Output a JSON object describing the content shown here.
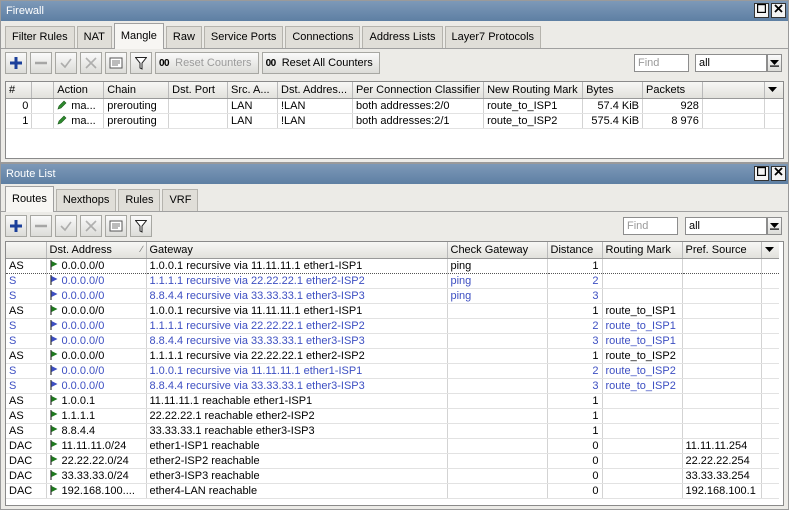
{
  "firewall": {
    "title": "Firewall",
    "tabs": [
      "Filter Rules",
      "NAT",
      "Mangle",
      "Raw",
      "Service Ports",
      "Connections",
      "Address Lists",
      "Layer7 Protocols"
    ],
    "active_tab": 2,
    "reset_counters_label": "Reset Counters",
    "reset_all_counters_label": "Reset All Counters",
    "counter_icon_text": "00",
    "find_placeholder": "Find",
    "filter_value": "all",
    "columns": [
      "#",
      "",
      "Action",
      "Chain",
      "Dst. Port",
      "Src. A...",
      "Dst. Addres...",
      "Per Connection Classifier",
      "New Routing Mark",
      "Bytes",
      "Packets"
    ],
    "rows": [
      {
        "num": "0",
        "action": "ma...",
        "chain": "prerouting",
        "dst_port": "",
        "src": "LAN",
        "dst": "!LAN",
        "pcc": "both addresses:2/0",
        "mark": "route_to_ISP1",
        "bytes": "57.4 KiB",
        "packets": "928"
      },
      {
        "num": "1",
        "action": "ma...",
        "chain": "prerouting",
        "dst_port": "",
        "src": "LAN",
        "dst": "!LAN",
        "pcc": "both addresses:2/1",
        "mark": "route_to_ISP2",
        "bytes": "575.4 KiB",
        "packets": "8 976"
      }
    ]
  },
  "routes": {
    "title": "Route List",
    "tabs": [
      "Routes",
      "Nexthops",
      "Rules",
      "VRF"
    ],
    "active_tab": 0,
    "find_placeholder": "Find",
    "filter_value": "all",
    "columns": [
      "",
      "Dst. Address",
      "Gateway",
      "Check Gateway",
      "Distance",
      "Routing Mark",
      "Pref. Source"
    ],
    "rows": [
      {
        "flags": "AS",
        "dst": "0.0.0.0/0",
        "gw": "1.0.0.1 recursive via 11.11.11.1 ether1-ISP1",
        "check": "ping",
        "dist": "1",
        "mark": "",
        "pref": "",
        "blue": false
      },
      {
        "flags": "S",
        "dst": "0.0.0.0/0",
        "gw": "1.1.1.1 recursive via 22.22.22.1 ether2-ISP2",
        "check": "ping",
        "dist": "2",
        "mark": "",
        "pref": "",
        "blue": true
      },
      {
        "flags": "S",
        "dst": "0.0.0.0/0",
        "gw": "8.8.4.4 recursive via 33.33.33.1 ether3-ISP3",
        "check": "ping",
        "dist": "3",
        "mark": "",
        "pref": "",
        "blue": true
      },
      {
        "flags": "AS",
        "dst": "0.0.0.0/0",
        "gw": "1.0.0.1 recursive via 11.11.11.1 ether1-ISP1",
        "check": "",
        "dist": "1",
        "mark": "route_to_ISP1",
        "pref": "",
        "blue": false
      },
      {
        "flags": "S",
        "dst": "0.0.0.0/0",
        "gw": "1.1.1.1 recursive via 22.22.22.1 ether2-ISP2",
        "check": "",
        "dist": "2",
        "mark": "route_to_ISP1",
        "pref": "",
        "blue": true
      },
      {
        "flags": "S",
        "dst": "0.0.0.0/0",
        "gw": "8.8.4.4 recursive via 33.33.33.1 ether3-ISP3",
        "check": "",
        "dist": "3",
        "mark": "route_to_ISP1",
        "pref": "",
        "blue": true
      },
      {
        "flags": "AS",
        "dst": "0.0.0.0/0",
        "gw": "1.1.1.1 recursive via 22.22.22.1 ether2-ISP2",
        "check": "",
        "dist": "1",
        "mark": "route_to_ISP2",
        "pref": "",
        "blue": false
      },
      {
        "flags": "S",
        "dst": "0.0.0.0/0",
        "gw": "1.0.0.1 recursive via 11.11.11.1 ether1-ISP1",
        "check": "",
        "dist": "2",
        "mark": "route_to_ISP2",
        "pref": "",
        "blue": true
      },
      {
        "flags": "S",
        "dst": "0.0.0.0/0",
        "gw": "8.8.4.4 recursive via 33.33.33.1 ether3-ISP3",
        "check": "",
        "dist": "3",
        "mark": "route_to_ISP2",
        "pref": "",
        "blue": true
      },
      {
        "flags": "AS",
        "dst": "1.0.0.1",
        "gw": "11.11.11.1 reachable ether1-ISP1",
        "check": "",
        "dist": "1",
        "mark": "",
        "pref": "",
        "blue": false
      },
      {
        "flags": "AS",
        "dst": "1.1.1.1",
        "gw": "22.22.22.1 reachable ether2-ISP2",
        "check": "",
        "dist": "1",
        "mark": "",
        "pref": "",
        "blue": false
      },
      {
        "flags": "AS",
        "dst": "8.8.4.4",
        "gw": "33.33.33.1 reachable ether3-ISP3",
        "check": "",
        "dist": "1",
        "mark": "",
        "pref": "",
        "blue": false
      },
      {
        "flags": "DAC",
        "dst": "11.11.11.0/24",
        "gw": "ether1-ISP1 reachable",
        "check": "",
        "dist": "0",
        "mark": "",
        "pref": "11.11.11.254",
        "blue": false
      },
      {
        "flags": "DAC",
        "dst": "22.22.22.0/24",
        "gw": "ether2-ISP2 reachable",
        "check": "",
        "dist": "0",
        "mark": "",
        "pref": "22.22.22.254",
        "blue": false
      },
      {
        "flags": "DAC",
        "dst": "33.33.33.0/24",
        "gw": "ether3-ISP3 reachable",
        "check": "",
        "dist": "0",
        "mark": "",
        "pref": "33.33.33.254",
        "blue": false
      },
      {
        "flags": "DAC",
        "dst": "192.168.100....",
        "gw": "ether4-LAN reachable",
        "check": "",
        "dist": "0",
        "mark": "",
        "pref": "192.168.100.1",
        "blue": false
      }
    ]
  },
  "colors": {
    "accent_blue": "#3d4fc2",
    "flag_green": "#1e7a1e",
    "titlebar": "#6a89ad"
  }
}
